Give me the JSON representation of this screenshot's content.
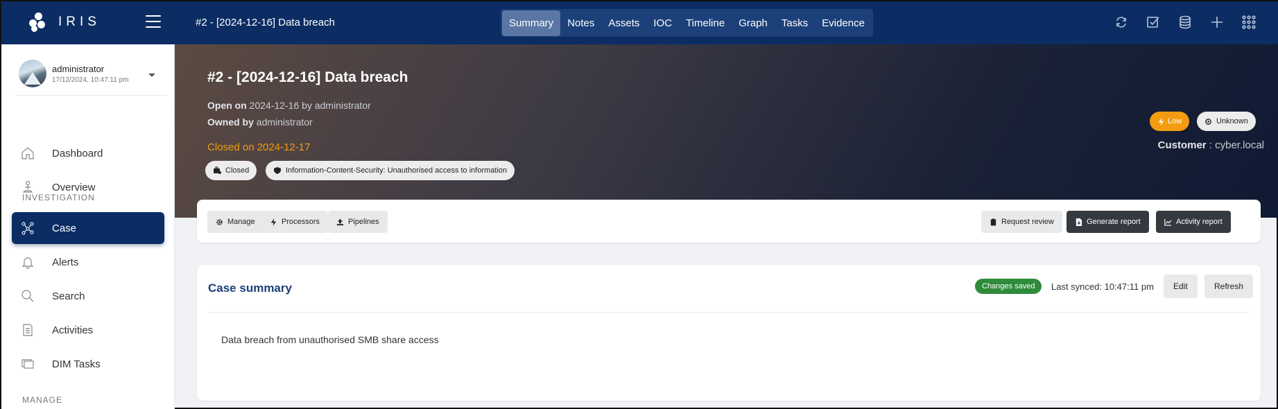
{
  "app": {
    "logo_text": "IRIS"
  },
  "header": {
    "case_title": "#2 - [2024-12-16] Data breach",
    "tabs": [
      {
        "label": "Summary",
        "active": true
      },
      {
        "label": "Notes"
      },
      {
        "label": "Assets"
      },
      {
        "label": "IOC"
      },
      {
        "label": "Timeline"
      },
      {
        "label": "Graph"
      },
      {
        "label": "Tasks"
      },
      {
        "label": "Evidence"
      }
    ],
    "icons": [
      "refresh-icon",
      "checkbox-icon",
      "database-icon",
      "plus-icon",
      "apps-grid-icon"
    ]
  },
  "sidebar": {
    "user": {
      "name": "administrator",
      "date": "17/12/2024, 10:47:11 pm"
    },
    "items": [
      {
        "label": "Dashboard",
        "icon": "home-icon"
      },
      {
        "label": "Overview",
        "icon": "person-icon"
      },
      {
        "label": "Case",
        "icon": "graph-nodes-icon",
        "active": true
      },
      {
        "label": "Alerts",
        "icon": "bell-icon"
      },
      {
        "label": "Search",
        "icon": "search-icon"
      },
      {
        "label": "Activities",
        "icon": "document-list-icon"
      },
      {
        "label": "DIM Tasks",
        "icon": "layers-icon"
      }
    ],
    "sections": {
      "investigation": "INVESTIGATION",
      "manage": "MANAGE"
    }
  },
  "hero": {
    "title": "#2 - [2024-12-16] Data breach",
    "open_label": "Open on",
    "open_value": "2024-12-16 by administrator",
    "owned_label": "Owned by",
    "owned_value": "administrator",
    "closed_text": "Closed on 2024-12-17",
    "chips": {
      "status": "Closed",
      "classification": "Information-Content-Security: Unauthorised access to information"
    },
    "severity": "Low",
    "outcome": "Unknown",
    "customer_label": "Customer",
    "customer_value": " : cyber.local"
  },
  "actions": {
    "manage": "Manage",
    "processors": "Processors",
    "pipelines": "Pipelines",
    "request_review": "Request review",
    "generate_report": "Generate report",
    "activity_report": "Activity report"
  },
  "summary": {
    "title": "Case summary",
    "saved_badge": "Changes saved",
    "last_synced": "Last synced: 10:47:11 pm",
    "edit": "Edit",
    "refresh": "Refresh",
    "text": "Data breach from unauthorised SMB share access"
  },
  "colors": {
    "topbar": "#0b2d63",
    "accent_orange": "#f39c12",
    "saved_green": "#2e8b3a",
    "summary_title": "#1c3f7a"
  }
}
